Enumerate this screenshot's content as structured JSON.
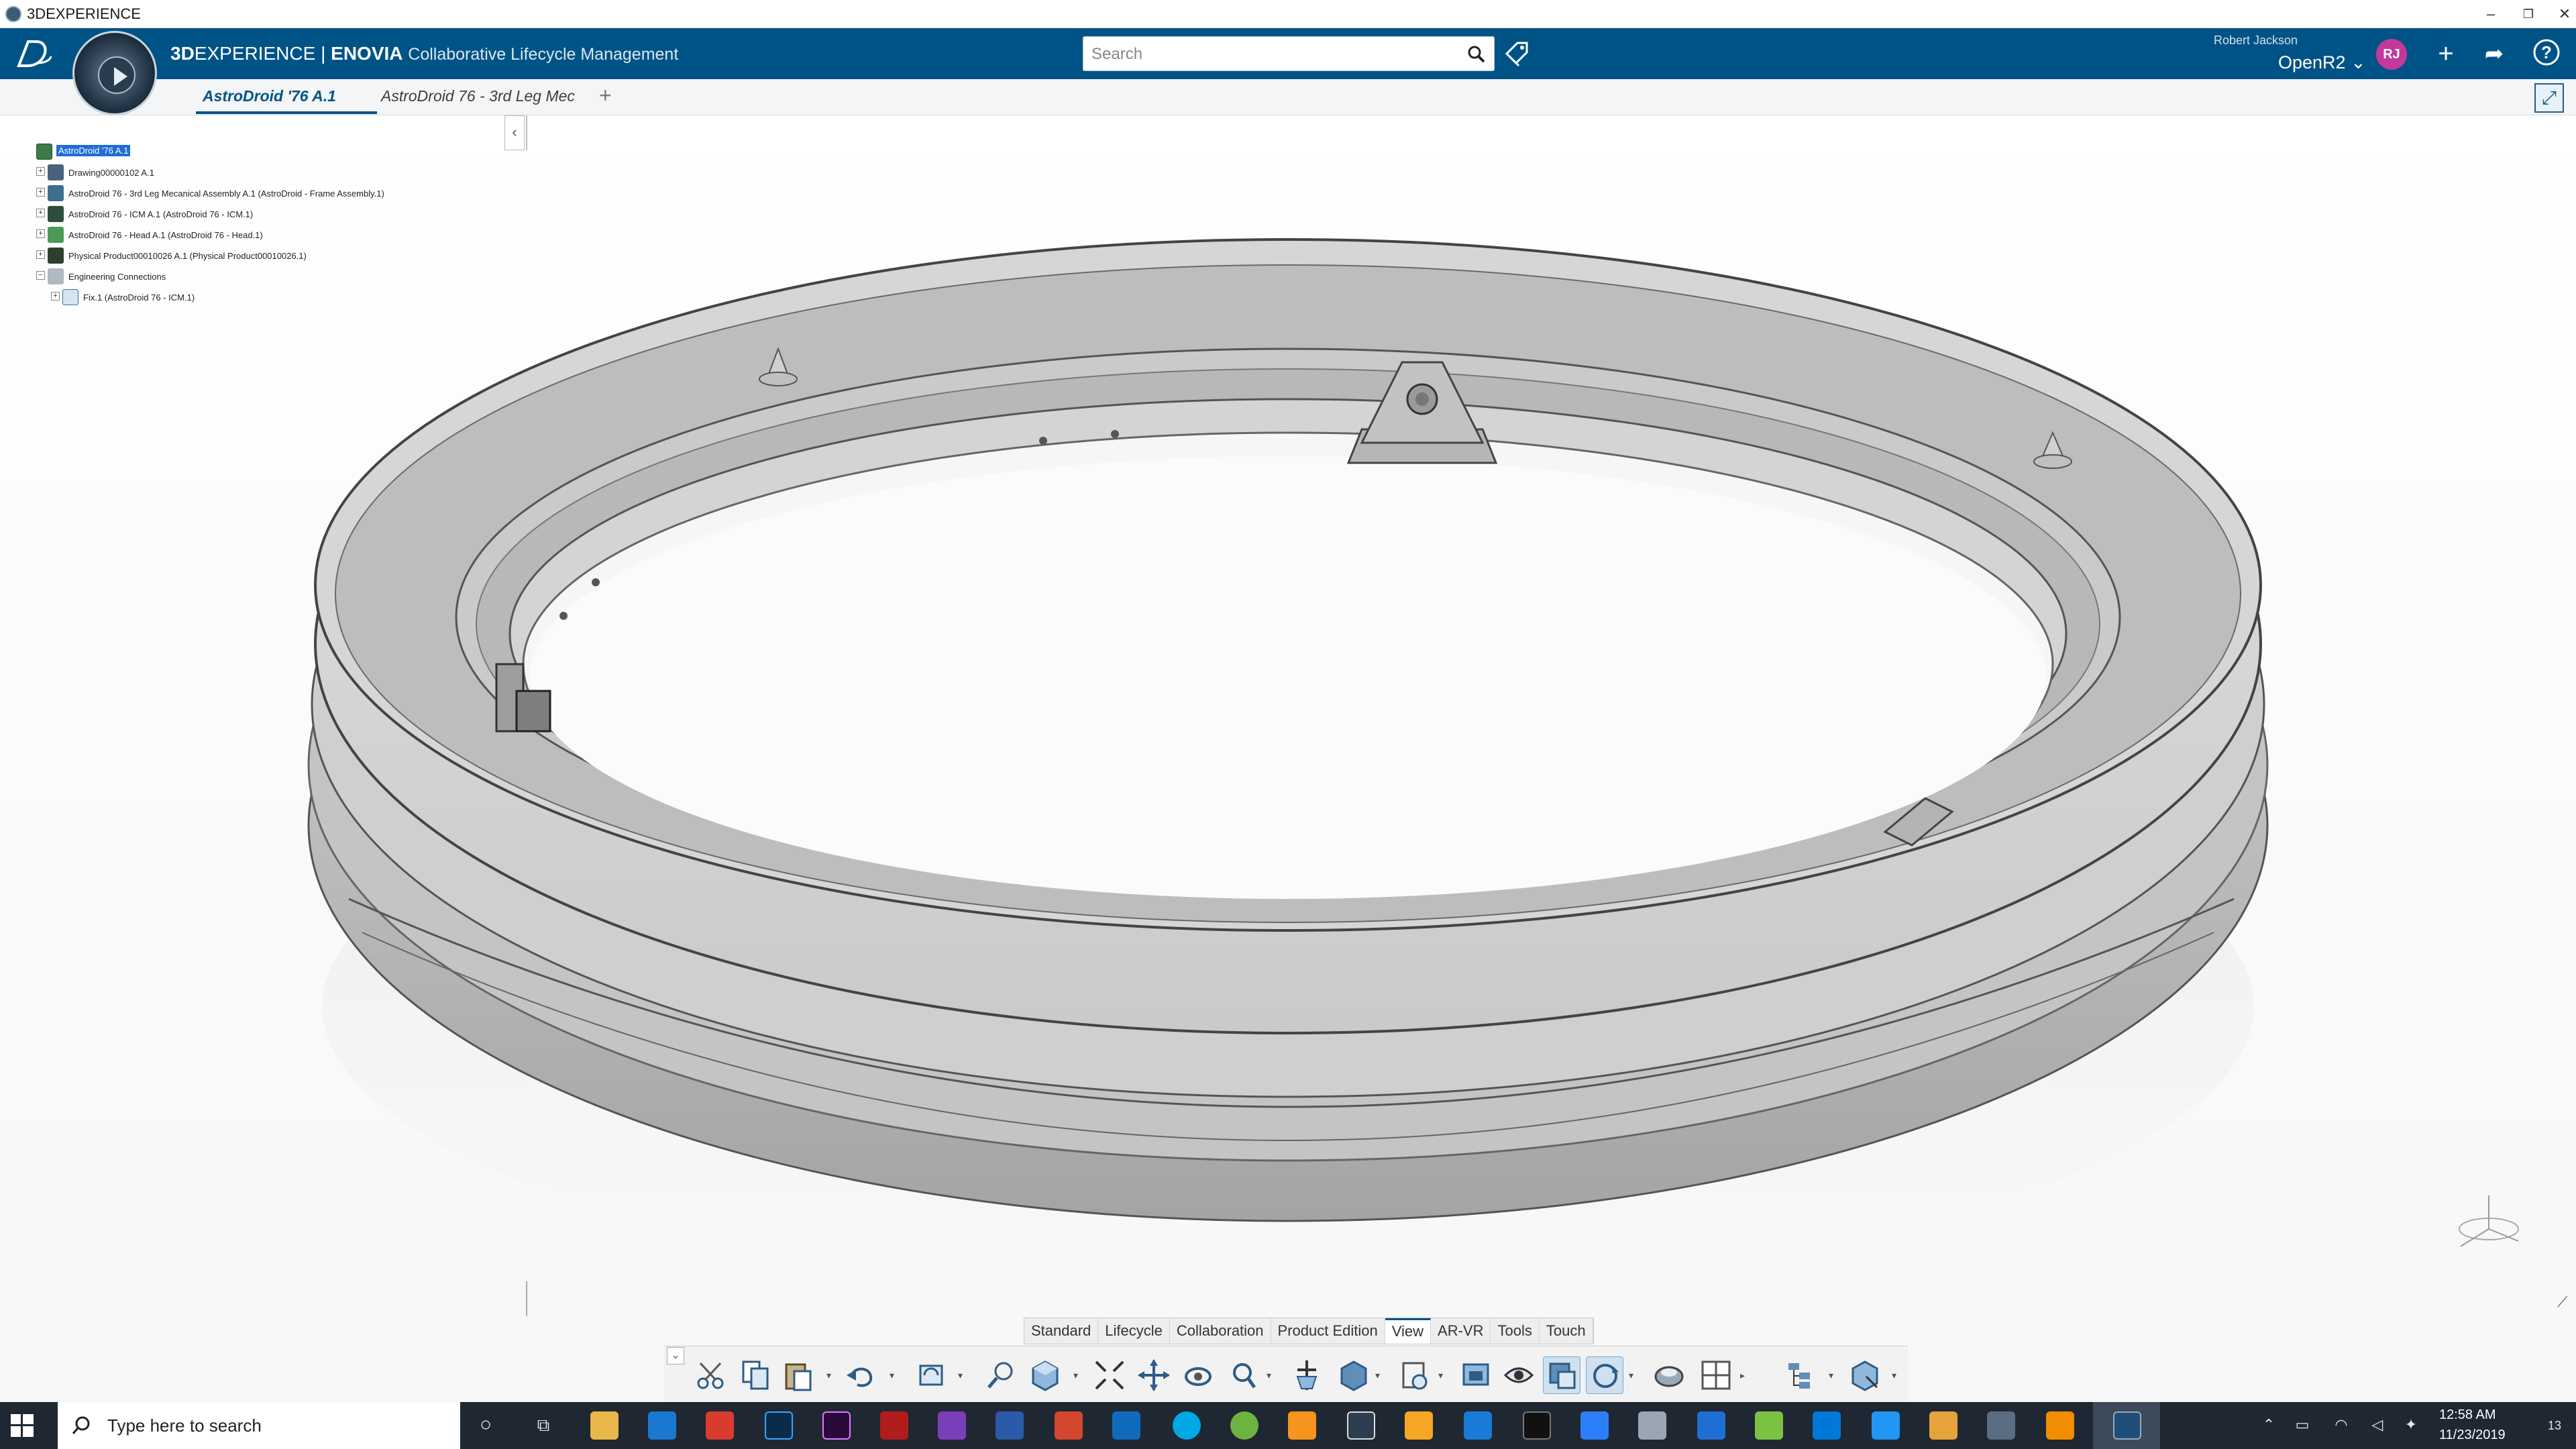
{
  "window": {
    "title": "3DEXPERIENCE"
  },
  "topbar": {
    "brand_bold": "3D",
    "brand_rest": "EXPERIENCE",
    "brand_sep": " | ",
    "brand_app": "ENOVIA",
    "brand_sub": "Collaborative Lifecycle Management",
    "search_placeholder": "Search",
    "user_name": "Robert Jackson",
    "tenant": "OpenR2",
    "avatar_initials": "RJ",
    "accent_color": "#005386"
  },
  "tabs": [
    {
      "label": "AstroDroid '76 A.1"
    },
    {
      "label": "AstroDroid 76 - 3rd Leg Mec"
    }
  ],
  "tree": {
    "root": "AstroDroid '76 A.1",
    "nodes": [
      {
        "label": "Drawing00000102 A.1"
      },
      {
        "label": "AstroDroid 76 - 3rd Leg Mecanical Assembly A.1 (AstroDroid - Frame Assembly.1)"
      },
      {
        "label": "AstroDroid 76 - ICM A.1 (AstroDroid 76 - ICM.1)"
      },
      {
        "label": "AstroDroid 76 - Head A.1 (AstroDroid 76 - Head.1)"
      },
      {
        "label": "Physical Product00010026 A.1 (Physical Product00010026.1)"
      },
      {
        "label": "Engineering Connections"
      },
      {
        "label": "Fix.1 (AstroDroid 76 - ICM.1)"
      }
    ]
  },
  "action_bar": {
    "tabs": [
      "Standard",
      "Lifecycle",
      "Collaboration",
      "Product Edition",
      "View",
      "AR-VR",
      "Tools",
      "Touch"
    ],
    "active_tab": "View",
    "icons": [
      "cut-icon",
      "copy-icon",
      "paste-icon",
      "undo-icon",
      "update-icon",
      "zoom-area-icon",
      "view-cube-icon",
      "fit-all-icon",
      "pan-icon",
      "rotate-icon",
      "zoom-icon",
      "normal-view-icon",
      "iso-view-icon",
      "render-style-icon",
      "screenshot-icon",
      "hide-show-icon",
      "swap-visible-icon",
      "cycle-icon",
      "lighting-icon",
      "multi-view-icon",
      "tree-reorder-icon",
      "3d-section-icon"
    ]
  },
  "taskbar": {
    "search_placeholder": "Type here to search",
    "time": "12:58 AM",
    "date": "11/23/2019",
    "notification_count": "13"
  }
}
